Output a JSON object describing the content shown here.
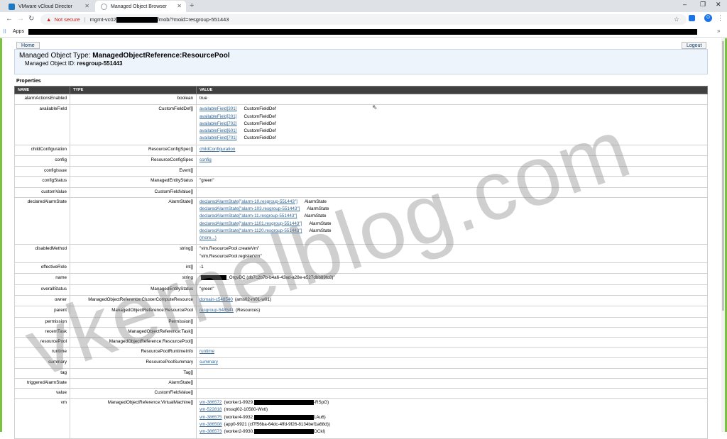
{
  "browser": {
    "tabs": [
      {
        "title": "VMware vCloud Director",
        "active": false,
        "fav_color": "#1d7ac2"
      },
      {
        "title": "Managed Object Browser",
        "active": true,
        "fav_color": "#9aa0a6"
      }
    ],
    "address": {
      "security": "Not secure",
      "url_prefix": "mgmt-vc02",
      "url_suffix": "/mob/?moid=resgroup-551443"
    },
    "bookmarks_label": "Apps"
  },
  "page": {
    "home_label": "Home",
    "logout_label": "Logout",
    "object_type_label": "Managed Object Type:",
    "object_type_value": "ManagedObjectReference:ResourcePool",
    "object_id_label": "Managed Object ID:",
    "object_id_value": "resgroup-551443",
    "properties_heading": "Properties",
    "columns": [
      "NAME",
      "TYPE",
      "VALUE"
    ]
  },
  "rows": [
    {
      "name": "alarmActionsEnabled",
      "type": "boolean",
      "values": [
        {
          "text": "true"
        }
      ]
    },
    {
      "name": "availableField",
      "type": "CustomFieldDef[]",
      "values": [
        {
          "link": "availableField[301]",
          "text": "CustomFieldDef"
        },
        {
          "link": "availableField[201]",
          "text": "CustomFieldDef"
        },
        {
          "link": "availableField[702]",
          "text": "CustomFieldDef"
        },
        {
          "link": "availableField[601]",
          "text": "CustomFieldDef"
        },
        {
          "link": "availableField[701]",
          "text": "CustomFieldDef"
        }
      ]
    },
    {
      "name": "childConfiguration",
      "type": "ResourceConfigSpec[]",
      "values": [
        {
          "link": "childConfiguration"
        }
      ]
    },
    {
      "name": "config",
      "type": "ResourceConfigSpec",
      "values": [
        {
          "link": "config"
        }
      ]
    },
    {
      "name": "configIssue",
      "type": "Event[]",
      "values": []
    },
    {
      "name": "configStatus",
      "type": "ManagedEntityStatus",
      "values": [
        {
          "text": "\"green\""
        }
      ]
    },
    {
      "name": "customValue",
      "type": "CustomFieldValue[]",
      "values": []
    },
    {
      "name": "declaredAlarmState",
      "type": "AlarmState[]",
      "values": [
        {
          "link": "declaredAlarmState[\"alarm-10.resgroup-551443\"]",
          "text": "AlarmState"
        },
        {
          "link": "declaredAlarmState[\"alarm-103.resgroup-551443\"]",
          "text": "AlarmState"
        },
        {
          "link": "declaredAlarmState[\"alarm-11.resgroup-551443\"]",
          "text": "AlarmState"
        },
        {
          "link": "declaredAlarmState[\"alarm-1101.resgroup-551443\"]",
          "text": "AlarmState"
        },
        {
          "link": "declaredAlarmState[\"alarm-1120.resgroup-551443\"]",
          "text": "AlarmState"
        },
        {
          "link": "(more...)"
        }
      ]
    },
    {
      "name": "disabledMethod",
      "type": "string[]",
      "values": [
        {
          "text": "\"vim.ResourcePool.createVm\""
        },
        {
          "text": "\"vim.ResourcePool.registerVm\""
        }
      ]
    },
    {
      "name": "effectiveRole",
      "type": "int[]",
      "values": [
        {
          "text": "-1"
        }
      ]
    },
    {
      "name": "name",
      "type": "string",
      "values": [
        {
          "text": "\"",
          "redact": true,
          "after": "_OrgvDC (db7c2b7b-b4a6-43ad-a28e-e527dbb89fc8)\""
        }
      ]
    },
    {
      "name": "overallStatus",
      "type": "ManagedEntityStatus",
      "values": [
        {
          "text": "\"green\""
        }
      ]
    },
    {
      "name": "owner",
      "type": "ManagedObjectReference:ClusterComputeResource",
      "values": [
        {
          "link": "domain-c548540",
          "text": "(ams02-m01-w01)"
        }
      ]
    },
    {
      "name": "parent",
      "type": "ManagedObjectReference:ResourcePool",
      "values": [
        {
          "link": "resgroup-548541",
          "text": "(Resources)"
        }
      ]
    },
    {
      "name": "permission",
      "type": "Permission[]",
      "values": []
    },
    {
      "name": "recentTask",
      "type": "ManagedObjectReference:Task[]",
      "values": []
    },
    {
      "name": "resourcePool",
      "type": "ManagedObjectReference:ResourcePool[]",
      "values": []
    },
    {
      "name": "runtime",
      "type": "ResourcePoolRuntimeInfo",
      "values": [
        {
          "link": "runtime"
        }
      ]
    },
    {
      "name": "summary",
      "type": "ResourcePoolSummary",
      "values": [
        {
          "link": "summary"
        }
      ]
    },
    {
      "name": "tag",
      "type": "Tag[]",
      "values": []
    },
    {
      "name": "triggeredAlarmState",
      "type": "AlarmState[]",
      "values": []
    },
    {
      "name": "value",
      "type": "CustomFieldValue[]",
      "values": []
    },
    {
      "name": "vm",
      "type": "ManagedObjectReference:VirtualMachine[]",
      "values": [
        {
          "link": "vm-386572",
          "text": "(worker1-9929.",
          "redact": true,
          "after": "-RSpG)"
        },
        {
          "link": "vm-522818",
          "text": "(mssql02-10580-Wvtl)"
        },
        {
          "link": "vm-386575",
          "text": "(worker4-9932.",
          "redact": true,
          "after": "1Au6)"
        },
        {
          "link": "vm-386508",
          "text": "(app0-9921 (cf7f56ba-64dc-4ffd-9f26-8134bef1a68d))"
        },
        {
          "link": "vm-386573",
          "text": "(worker2-9930.",
          "redact": true,
          "after": "OCkl)"
        }
      ]
    }
  ],
  "watermark": "vkernelblog.com"
}
